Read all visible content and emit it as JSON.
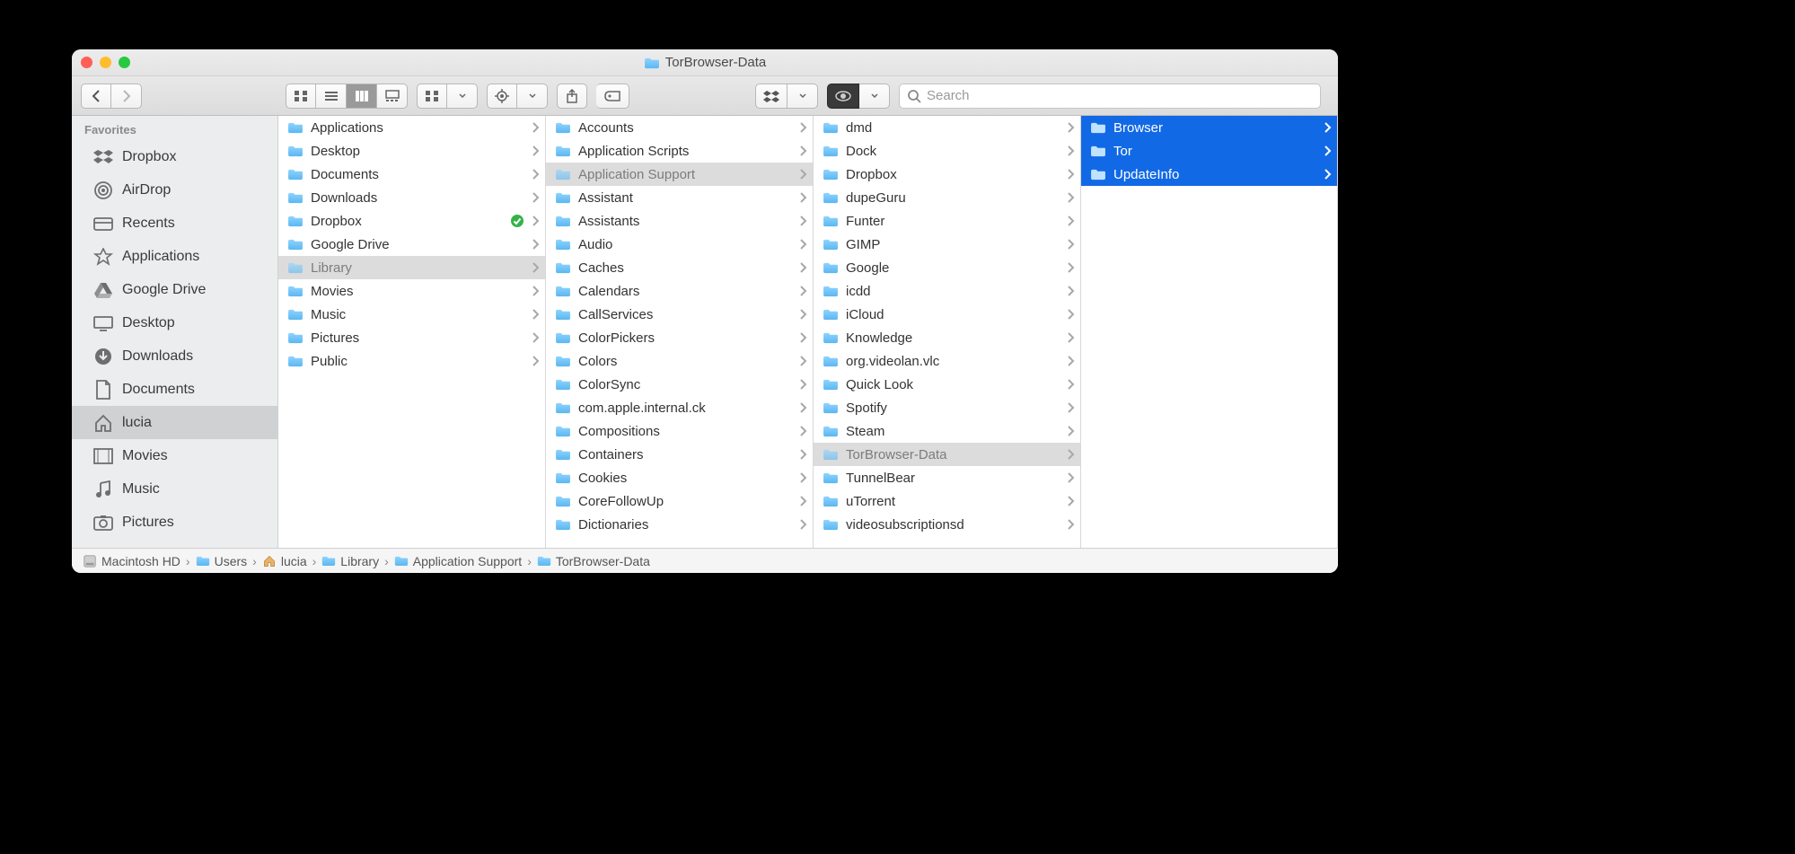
{
  "window": {
    "title": "TorBrowser-Data"
  },
  "toolbar": {
    "search_placeholder": "Search"
  },
  "sidebar": {
    "header": "Favorites",
    "items": [
      {
        "icon": "dropbox",
        "label": "Dropbox",
        "selected": false
      },
      {
        "icon": "airdrop",
        "label": "AirDrop",
        "selected": false
      },
      {
        "icon": "recents",
        "label": "Recents",
        "selected": false
      },
      {
        "icon": "apps",
        "label": "Applications",
        "selected": false
      },
      {
        "icon": "gdrive",
        "label": "Google Drive",
        "selected": false
      },
      {
        "icon": "desktop",
        "label": "Desktop",
        "selected": false
      },
      {
        "icon": "downloads",
        "label": "Downloads",
        "selected": false
      },
      {
        "icon": "documents",
        "label": "Documents",
        "selected": false
      },
      {
        "icon": "home",
        "label": "lucia",
        "selected": true
      },
      {
        "icon": "movies",
        "label": "Movies",
        "selected": false
      },
      {
        "icon": "music",
        "label": "Music",
        "selected": false
      },
      {
        "icon": "pictures",
        "label": "Pictures",
        "selected": false
      }
    ]
  },
  "columns": [
    {
      "items": [
        {
          "name": "Applications",
          "arrow": true
        },
        {
          "name": "Desktop",
          "arrow": true
        },
        {
          "name": "Documents",
          "arrow": true
        },
        {
          "name": "Downloads",
          "arrow": true
        },
        {
          "name": "Dropbox",
          "arrow": true,
          "badge": "sync"
        },
        {
          "name": "Google Drive",
          "arrow": true
        },
        {
          "name": "Library",
          "arrow": true,
          "selected": "grey"
        },
        {
          "name": "Movies",
          "arrow": true
        },
        {
          "name": "Music",
          "arrow": true
        },
        {
          "name": "Pictures",
          "arrow": true
        },
        {
          "name": "Public",
          "arrow": true
        }
      ]
    },
    {
      "items": [
        {
          "name": "Accounts",
          "arrow": true
        },
        {
          "name": "Application Scripts",
          "arrow": true
        },
        {
          "name": "Application Support",
          "arrow": true,
          "selected": "grey"
        },
        {
          "name": "Assistant",
          "arrow": true
        },
        {
          "name": "Assistants",
          "arrow": true
        },
        {
          "name": "Audio",
          "arrow": true
        },
        {
          "name": "Caches",
          "arrow": true
        },
        {
          "name": "Calendars",
          "arrow": true
        },
        {
          "name": "CallServices",
          "arrow": true
        },
        {
          "name": "ColorPickers",
          "arrow": true
        },
        {
          "name": "Colors",
          "arrow": true
        },
        {
          "name": "ColorSync",
          "arrow": true
        },
        {
          "name": "com.apple.internal.ck",
          "arrow": true
        },
        {
          "name": "Compositions",
          "arrow": true
        },
        {
          "name": "Containers",
          "arrow": true
        },
        {
          "name": "Cookies",
          "arrow": true
        },
        {
          "name": "CoreFollowUp",
          "arrow": true
        },
        {
          "name": "Dictionaries",
          "arrow": true
        }
      ]
    },
    {
      "items": [
        {
          "name": "dmd",
          "arrow": true
        },
        {
          "name": "Dock",
          "arrow": true
        },
        {
          "name": "Dropbox",
          "arrow": true
        },
        {
          "name": "dupeGuru",
          "arrow": true
        },
        {
          "name": "Funter",
          "arrow": true
        },
        {
          "name": "GIMP",
          "arrow": true
        },
        {
          "name": "Google",
          "arrow": true
        },
        {
          "name": "icdd",
          "arrow": true
        },
        {
          "name": "iCloud",
          "arrow": true
        },
        {
          "name": "Knowledge",
          "arrow": true
        },
        {
          "name": "org.videolan.vlc",
          "arrow": true
        },
        {
          "name": "Quick Look",
          "arrow": true
        },
        {
          "name": "Spotify",
          "arrow": true
        },
        {
          "name": "Steam",
          "arrow": true
        },
        {
          "name": "TorBrowser-Data",
          "arrow": true,
          "selected": "grey"
        },
        {
          "name": "TunnelBear",
          "arrow": true
        },
        {
          "name": "uTorrent",
          "arrow": true
        },
        {
          "name": "videosubscriptionsd",
          "arrow": true
        }
      ]
    },
    {
      "items": [
        {
          "name": "Browser",
          "arrow": true,
          "selected": "blue"
        },
        {
          "name": "Tor",
          "arrow": true,
          "selected": "blue"
        },
        {
          "name": "UpdateInfo",
          "arrow": true,
          "selected": "blue"
        }
      ]
    }
  ],
  "pathbar": [
    {
      "icon": "disk",
      "label": "Macintosh HD"
    },
    {
      "icon": "folder",
      "label": "Users"
    },
    {
      "icon": "home",
      "label": "lucia"
    },
    {
      "icon": "folder",
      "label": "Library"
    },
    {
      "icon": "folder",
      "label": "Application Support"
    },
    {
      "icon": "folder",
      "label": "TorBrowser-Data"
    }
  ]
}
